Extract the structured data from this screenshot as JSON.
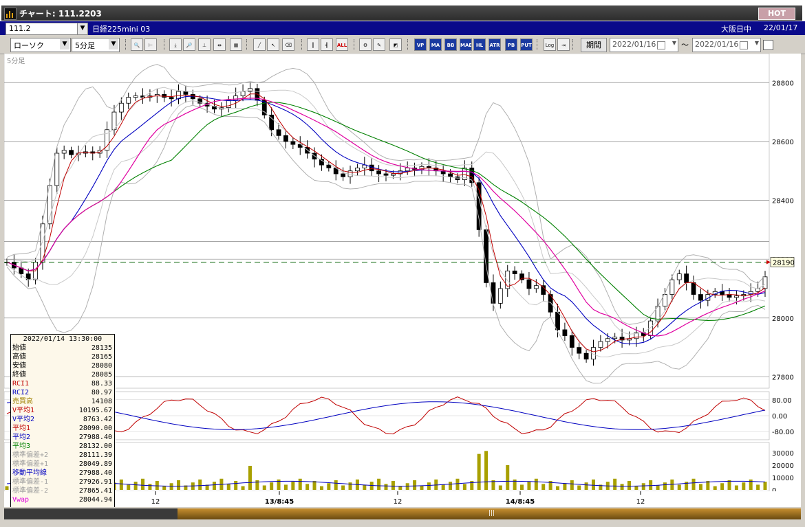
{
  "window": {
    "title": "チャート: 111.2203",
    "hot_label": "HOT"
  },
  "instrument": {
    "code": "111.2",
    "name": "日経225mini 03",
    "market": "大阪日中",
    "date": "22/01/17"
  },
  "toolbar": {
    "chart_type": "ローソク",
    "interval": "5分足",
    "period_label": "期間",
    "date_from": "2022/01/16",
    "date_to": "2022/01/16",
    "range_sep": "〜",
    "buttons": [
      {
        "name": "zoom-in",
        "glyph": "🔍"
      },
      {
        "name": "fit",
        "glyph": "⊢"
      },
      {
        "name": "pan-down",
        "glyph": "⤓"
      },
      {
        "name": "zoom-out",
        "glyph": "🔎"
      },
      {
        "name": "crosshair",
        "glyph": "⊥"
      },
      {
        "name": "range",
        "glyph": "⇹"
      },
      {
        "name": "calc",
        "glyph": "▦"
      },
      {
        "name": "line-tool",
        "glyph": "╱"
      },
      {
        "name": "pointer",
        "glyph": "↖"
      },
      {
        "name": "eraser",
        "glyph": "⌫"
      },
      {
        "name": "candle",
        "glyph": "┃"
      },
      {
        "name": "bar",
        "glyph": "┫"
      },
      {
        "name": "all",
        "glyph": "ALL"
      },
      {
        "name": "settings",
        "glyph": "⚙"
      },
      {
        "name": "wrench",
        "glyph": "✎"
      },
      {
        "name": "palette",
        "glyph": "◩"
      },
      {
        "name": "vp",
        "glyph": "VP"
      },
      {
        "name": "ma",
        "glyph": "MA"
      },
      {
        "name": "bb",
        "glyph": "BB"
      },
      {
        "name": "mae",
        "glyph": "MAE"
      },
      {
        "name": "hl",
        "glyph": "HL"
      },
      {
        "name": "atr",
        "glyph": "ATR"
      },
      {
        "name": "pb",
        "glyph": "PB"
      },
      {
        "name": "put",
        "glyph": "PUT"
      },
      {
        "name": "log",
        "glyph": "Log"
      },
      {
        "name": "export",
        "glyph": "⇥"
      }
    ]
  },
  "chart_data": {
    "type": "candlestick",
    "pane_label": "5分足",
    "price_axis": {
      "ticks": [
        28800,
        28600,
        28400,
        28200,
        28000,
        27800
      ],
      "range": [
        27800,
        28880
      ]
    },
    "current_price": 28190,
    "time_labels": [
      "12",
      "13/8:45",
      "12",
      "14/8:45",
      "12"
    ],
    "price_path": [
      28190,
      28170,
      28150,
      28130,
      28190,
      28320,
      28450,
      28560,
      28570,
      28555,
      28560,
      28565,
      28560,
      28570,
      28640,
      28700,
      28730,
      28750,
      28755,
      28750,
      28755,
      28760,
      28750,
      28745,
      28770,
      28760,
      28745,
      28730,
      28720,
      28710,
      28715,
      28740,
      28755,
      28770,
      28780,
      28740,
      28690,
      28640,
      28620,
      28600,
      28590,
      28580,
      28560,
      28540,
      28520,
      28510,
      28490,
      28480,
      28500,
      28510,
      28520,
      28500,
      28490,
      28485,
      28490,
      28500,
      28510,
      28505,
      28515,
      28510,
      28500,
      28490,
      28480,
      28470,
      28510,
      28460,
      28300,
      28120,
      28050,
      28100,
      28160,
      28150,
      28130,
      28100,
      28110,
      28080,
      28020,
      27960,
      27940,
      27900,
      27880,
      27860,
      27900,
      27920,
      27930,
      27935,
      27925,
      27930,
      27950,
      27940,
      27990,
      28040,
      28080,
      28130,
      28150,
      28120,
      28080,
      28060,
      28080,
      28090,
      28080,
      28070,
      28075,
      28080,
      28090,
      28100,
      28140
    ],
    "oscillator": {
      "ticks": [
        "80.00",
        "0.00",
        "-80.00"
      ]
    },
    "volume": {
      "ticks": [
        30000,
        20000,
        10000,
        0
      ]
    }
  },
  "data_window": {
    "timestamp": "2022/01/14  13:30:00",
    "rows": [
      {
        "k": "始値",
        "v": "28135",
        "c": "#000"
      },
      {
        "k": "高値",
        "v": "28165",
        "c": "#000"
      },
      {
        "k": "安値",
        "v": "28080",
        "c": "#000"
      },
      {
        "k": "終値",
        "v": "28085",
        "c": "#000"
      },
      {
        "k": "RCI1",
        "v": "88.33",
        "c": "#c00000"
      },
      {
        "k": "RCI2",
        "v": "80.97",
        "c": "#0000c0"
      },
      {
        "k": "売買高",
        "v": "14108",
        "c": "#a08000"
      },
      {
        "k": "V平均1",
        "v": "10195.67",
        "c": "#c00000"
      },
      {
        "k": "V平均2",
        "v": "8763.42",
        "c": "#0000c0"
      },
      {
        "k": "平均1",
        "v": "28090.00",
        "c": "#c00000"
      },
      {
        "k": "平均2",
        "v": "27988.40",
        "c": "#0000c0"
      },
      {
        "k": "平均3",
        "v": "28132.00",
        "c": "#008000"
      },
      {
        "k": "標準偏差+2",
        "v": "28111.39",
        "c": "#a0a0a0"
      },
      {
        "k": "標準偏差+1",
        "v": "28049.89",
        "c": "#a0a0a0"
      },
      {
        "k": "移動平均線",
        "v": "27988.40",
        "c": "#0000c0"
      },
      {
        "k": "標準偏差-1",
        "v": "27926.91",
        "c": "#a0a0a0"
      },
      {
        "k": "標準偏差-2",
        "v": "27865.41",
        "c": "#a0a0a0"
      },
      {
        "k": "Vwap",
        "v": "28044.94",
        "c": "#e000e0"
      }
    ]
  }
}
